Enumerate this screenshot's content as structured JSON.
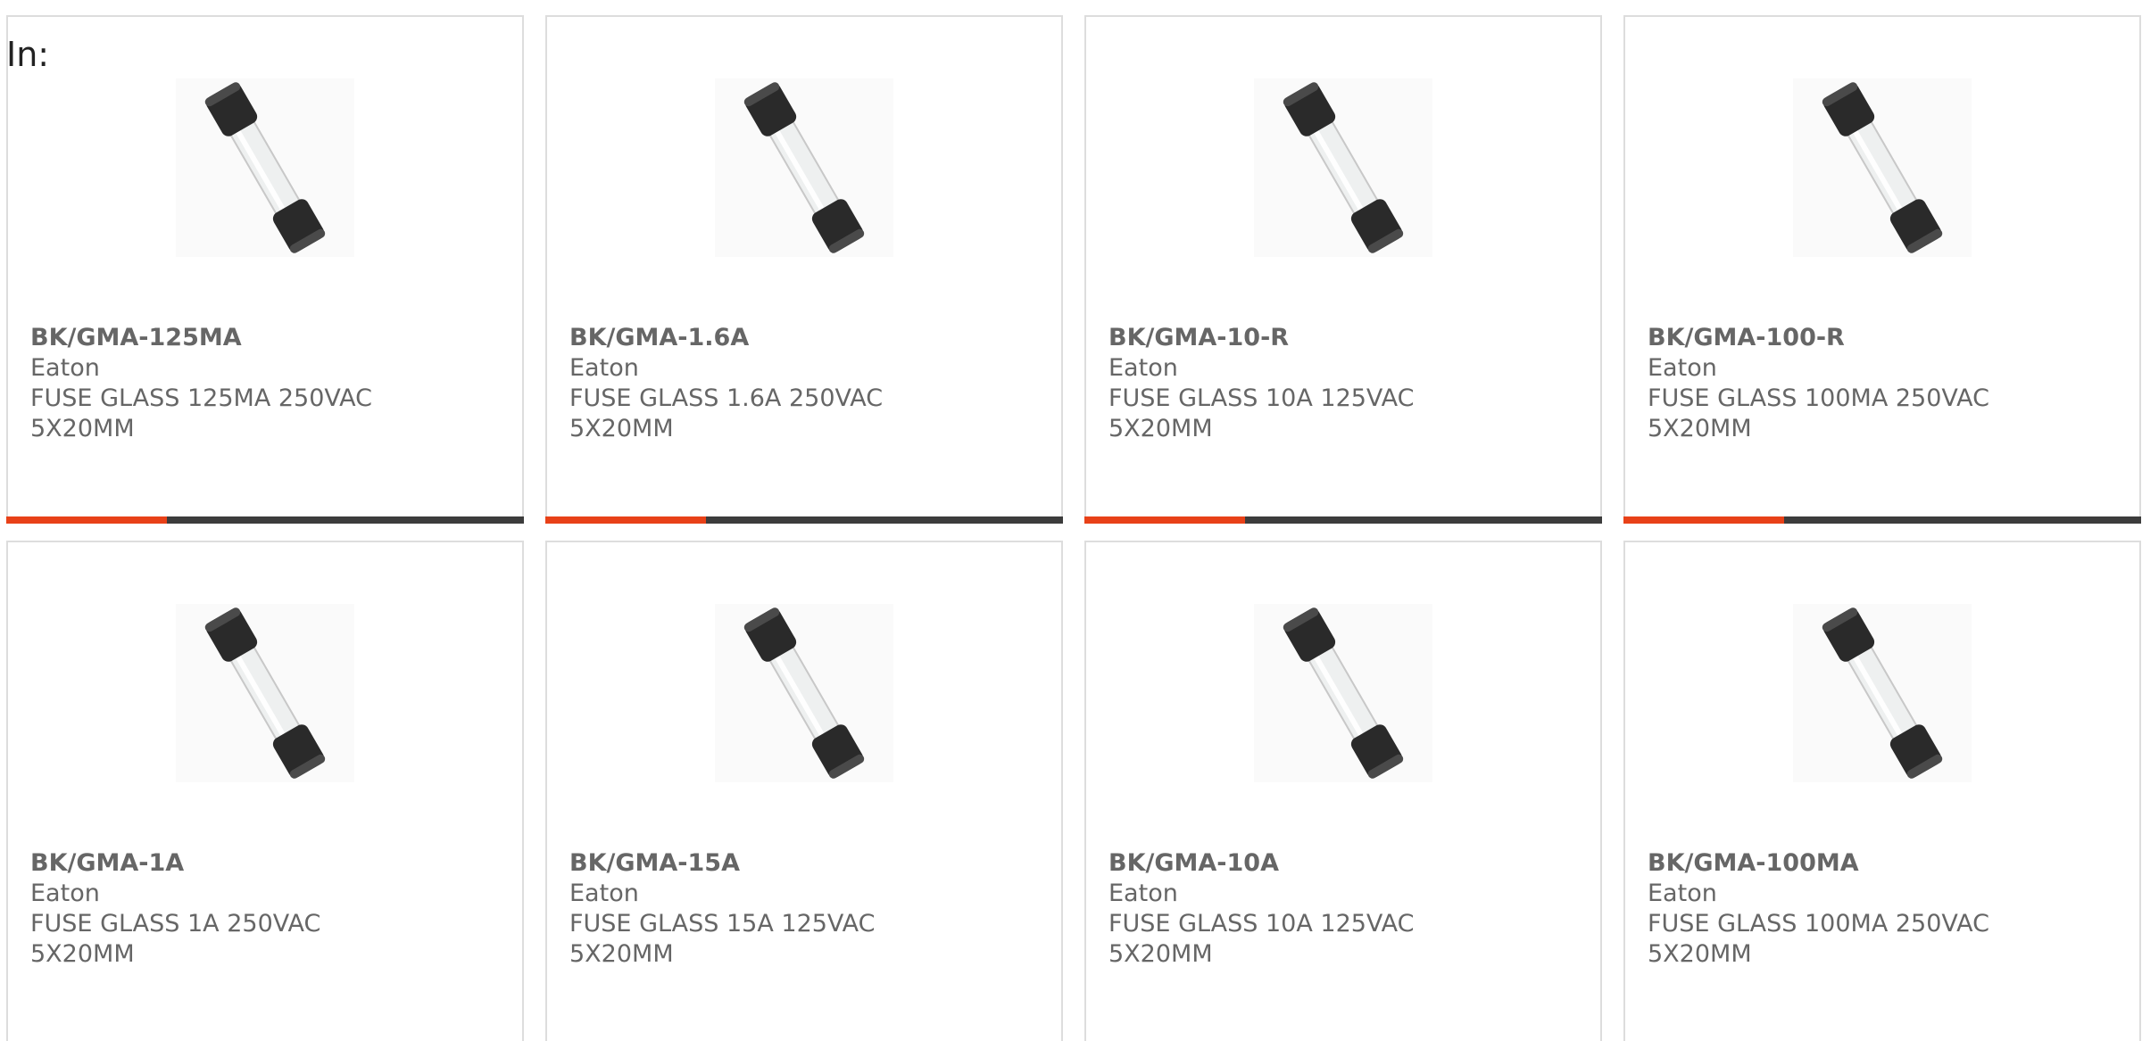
{
  "filter_label": "In:",
  "colors": {
    "accent": "#e84118",
    "bar": "#3c3c3c",
    "text": "#666666",
    "border": "#dddddd"
  },
  "products": [
    {
      "part": "BK/GMA-125MA",
      "brand": "Eaton",
      "description": "FUSE GLASS 125MA 250VAC 5X20MM",
      "image_icon": "glass-fuse-icon",
      "progress": 0.31
    },
    {
      "part": "BK/GMA-1.6A",
      "brand": "Eaton",
      "description": "FUSE GLASS 1.6A 250VAC 5X20MM",
      "image_icon": "glass-fuse-icon",
      "progress": 0.31
    },
    {
      "part": "BK/GMA-10-R",
      "brand": "Eaton",
      "description": "FUSE GLASS 10A 125VAC 5X20MM",
      "image_icon": "glass-fuse-icon",
      "progress": 0.31
    },
    {
      "part": "BK/GMA-100-R",
      "brand": "Eaton",
      "description": "FUSE GLASS 100MA 250VAC 5X20MM",
      "image_icon": "glass-fuse-icon",
      "progress": 0.31
    },
    {
      "part": "BK/GMA-1A",
      "brand": "Eaton",
      "description": "FUSE GLASS 1A 250VAC 5X20MM",
      "image_icon": "glass-fuse-icon",
      "progress": 0.31
    },
    {
      "part": "BK/GMA-15A",
      "brand": "Eaton",
      "description": "FUSE GLASS 15A 125VAC 5X20MM",
      "image_icon": "glass-fuse-icon",
      "progress": 0.31
    },
    {
      "part": "BK/GMA-10A",
      "brand": "Eaton",
      "description": "FUSE GLASS 10A 125VAC 5X20MM",
      "image_icon": "glass-fuse-icon",
      "progress": 0.31
    },
    {
      "part": "BK/GMA-100MA",
      "brand": "Eaton",
      "description": "FUSE GLASS 100MA 250VAC 5X20MM",
      "image_icon": "glass-fuse-icon",
      "progress": 0.31
    }
  ]
}
